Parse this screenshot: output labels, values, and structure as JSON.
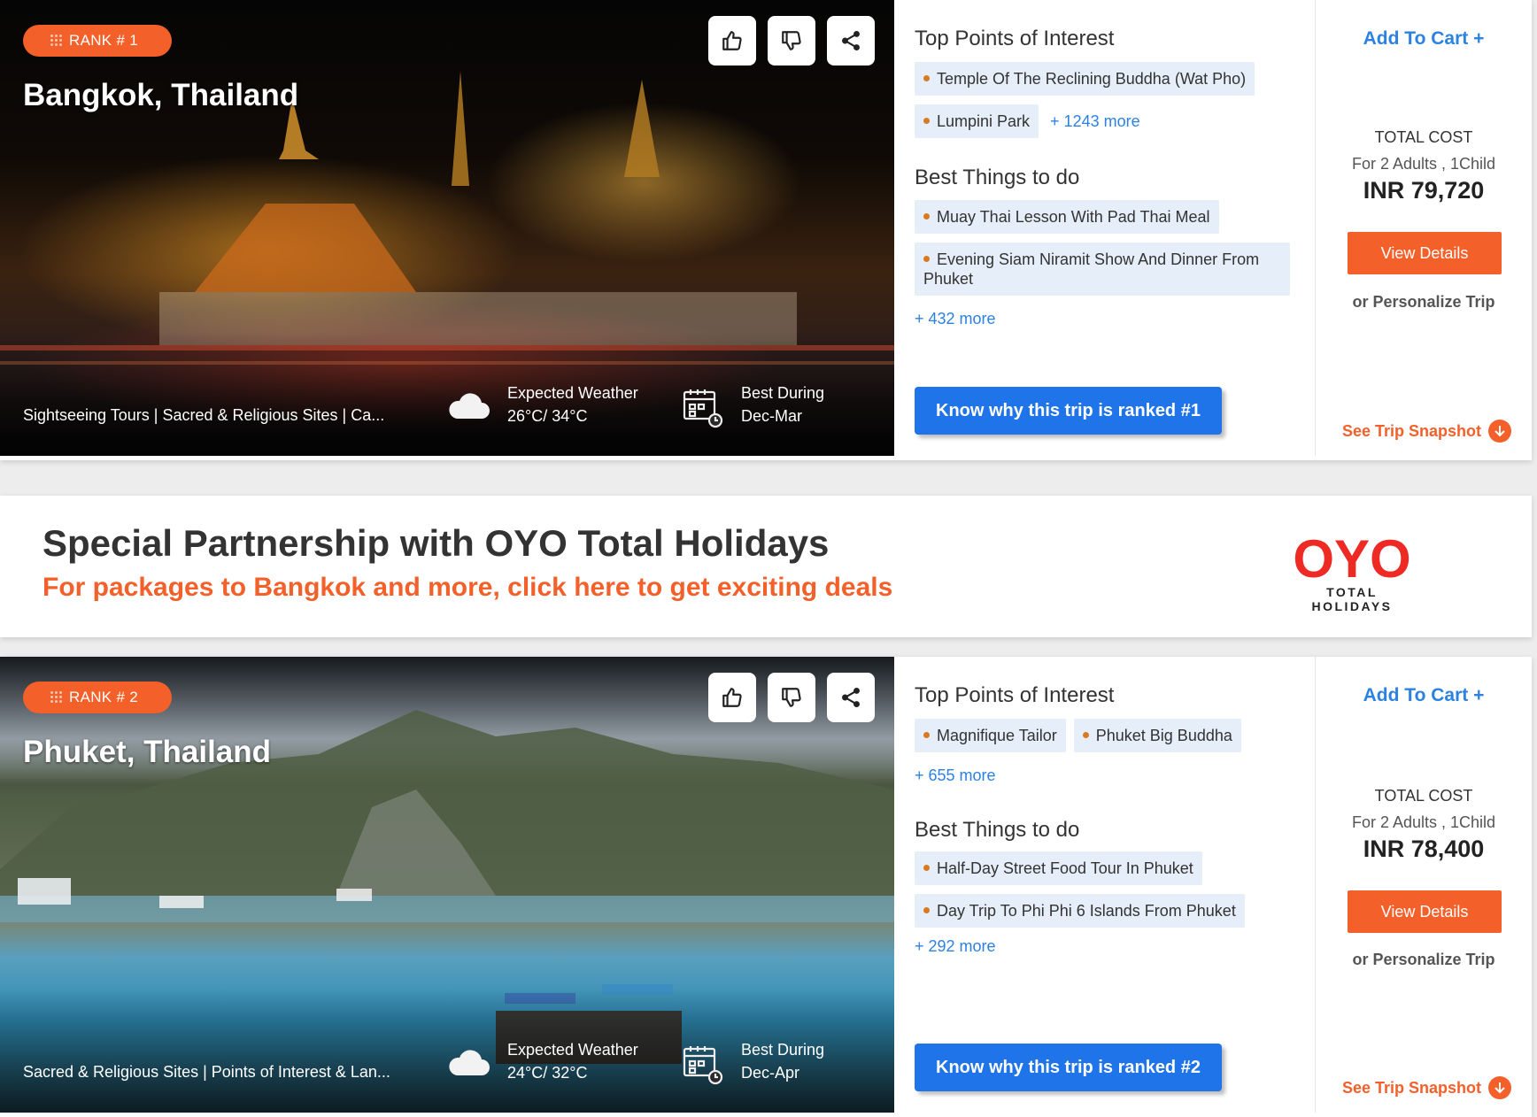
{
  "cards": [
    {
      "rank_label": "RANK # 1",
      "city": "Bangkok, Thailand",
      "tags_line": "Sightseeing Tours | Sacred & Religious Sites | Ca...",
      "weather_label": "Expected Weather",
      "weather_value": "26°C/ 34°C",
      "season_label": "Best During",
      "season_value": "Dec-Mar",
      "poi_title": "Top Points of Interest",
      "poi": [
        "Temple Of The Reclining Buddha (Wat Pho)",
        "Lumpini Park"
      ],
      "poi_more": "+ 1243 more",
      "todo_title": "Best Things to do",
      "todo": [
        "Muay Thai Lesson With Pad Thai Meal",
        "Evening Siam Niramit Show And Dinner From Phuket"
      ],
      "todo_more": "+ 432 more",
      "rank_button": "Know why this trip is ranked #1",
      "add_to_cart": "Add To Cart +",
      "total_cost_label": "TOTAL COST",
      "travellers": "For 2 Adults , 1Child",
      "price": "INR 79,720",
      "view_details": "View Details",
      "personalize": "or Personalize Trip",
      "snapshot": "See Trip Snapshot"
    },
    {
      "rank_label": "RANK # 2",
      "city": "Phuket, Thailand",
      "tags_line": "Sacred & Religious Sites | Points of Interest & Lan...",
      "weather_label": "Expected Weather",
      "weather_value": "24°C/ 32°C",
      "season_label": "Best During",
      "season_value": "Dec-Apr",
      "poi_title": "Top Points of Interest",
      "poi": [
        "Magnifique Tailor",
        "Phuket Big Buddha"
      ],
      "poi_more": "+ 655 more",
      "todo_title": "Best Things to do",
      "todo": [
        "Half-Day Street Food Tour In Phuket",
        "Day Trip To Phi Phi 6 Islands From Phuket"
      ],
      "todo_more": "+ 292 more",
      "rank_button": "Know why this trip is ranked #2",
      "add_to_cart": "Add To Cart +",
      "total_cost_label": "TOTAL COST",
      "travellers": "For 2 Adults , 1Child",
      "price": "INR 78,400",
      "view_details": "View Details",
      "personalize": "or Personalize Trip",
      "snapshot": "See Trip Snapshot"
    }
  ],
  "banner": {
    "title": "Special Partnership with OYO Total Holidays",
    "subtitle": "For packages to Bangkok and more, click here to get exciting deals",
    "logo_text": "OYO",
    "logo_subtext": "TOTAL HOLIDAYS"
  },
  "icons": [
    "thumbs-up-icon",
    "thumbs-down-icon",
    "share-icon",
    "cloud-icon",
    "calendar-icon",
    "arrow-down-circle-icon"
  ],
  "colors": {
    "accent_orange": "#f4602a",
    "link_blue": "#2c82e0",
    "button_blue": "#1f74e9",
    "chip_bg": "#e5eef9",
    "oyo_red": "#ee2a24"
  }
}
